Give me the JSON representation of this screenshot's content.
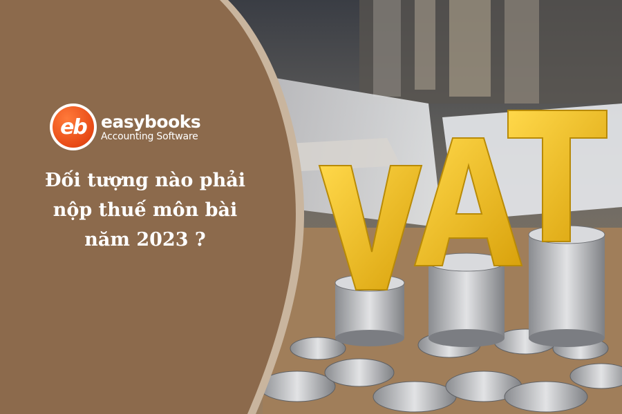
{
  "brand": {
    "logo_mark": "eb",
    "name": "easybooks",
    "tagline": "Accounting Software"
  },
  "headline": {
    "line1": "Đối tượng nào phải",
    "line2": "nộp thuế môn bài",
    "line3": "năm 2023 ?"
  },
  "photo": {
    "letters": [
      "V",
      "A",
      "T"
    ]
  },
  "colors": {
    "panel_brown": "#8c6a4c",
    "panel_border": "#c9b59e",
    "logo_orange": "#e84a16",
    "vat_yellow": "#f2c21b",
    "text": "#ffffff"
  }
}
